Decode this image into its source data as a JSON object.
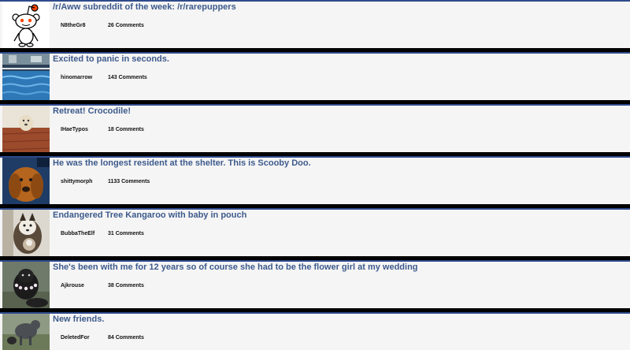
{
  "posts": [
    {
      "title": "/r/Aww subreddit of the week: /r/rarepuppers",
      "author": "N8theGr8",
      "comments": "26 Comments",
      "thumb": "reddit-alien-icon"
    },
    {
      "title": "Excited to panic in seconds.",
      "author": "hinomarrow",
      "comments": "143 Comments",
      "thumb": "pool-photo"
    },
    {
      "title": "Retreat! Crocodile!",
      "author": "IHaeTypos",
      "comments": "18 Comments",
      "thumb": "dog-hallway-photo"
    },
    {
      "title": "He was the longest resident at the shelter. This is Scooby Doo.",
      "author": "shittymorph",
      "comments": "1133 Comments",
      "thumb": "bloodhound-photo"
    },
    {
      "title": "Endangered Tree Kangaroo with baby in pouch",
      "author": "BubbaTheElf",
      "comments": "31 Comments",
      "thumb": "tree-kangaroo-photo"
    },
    {
      "title": "She's been with me for 12 years so of course she had to be the flower girl at my wedding",
      "author": "Ajkrouse",
      "comments": "38 Comments",
      "thumb": "black-dog-flowers-photo"
    },
    {
      "title": "New friends.",
      "author": "DeletedFor",
      "comments": "84 Comments",
      "thumb": "dogs-yard-photo"
    }
  ]
}
